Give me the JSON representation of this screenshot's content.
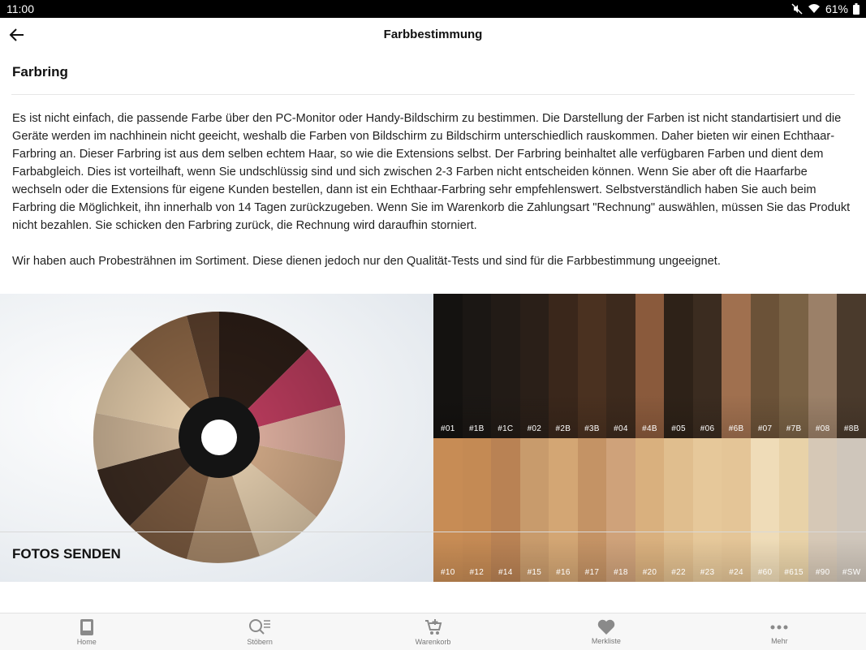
{
  "status_bar": {
    "time": "11:00",
    "battery": "61%"
  },
  "app_bar": {
    "title": "Farbbestimmung"
  },
  "section": {
    "title": "Farbring",
    "paragraphs": [
      "Es ist nicht einfach, die passende Farbe über den PC-Monitor oder Handy-Bildschirm zu bestimmen. Die Darstellung der Farben ist nicht standartisiert und die Geräte werden im nachhinein nicht geeicht, weshalb die Farben von Bildschirm zu Bildschirm unterschiedlich rauskommen. Daher bieten wir einen Echthaar-Farbring an. Dieser Farbring ist aus dem selben echtem Haar, so wie die Extensions selbst. Der Farbring beinhaltet alle verfügbaren Farben und dient dem Farbabgleich. Dies ist vorteilhaft, wenn Sie undschlüssig sind und sich zwischen 2-3 Farben nicht entscheiden können. Wenn Sie aber oft die Haarfarbe wechseln oder die Extensions für eigene Kunden bestellen, dann ist ein Echthaar-Farbring sehr empfehlenswert. Selbstverständlich haben Sie auch beim Farbring die Möglichkeit, ihn innerhalb von 14 Tagen zurückzugeben. Wenn Sie im Warenkorb die Zahlungsart \"Rechnung\" auswählen, müssen Sie das Produkt nicht bezahlen. Sie schicken den Farbring zurück, die Rechnung wird daraufhin storniert.",
      "Wir haben auch Probesträhnen im Sortiment. Diese dienen jedoch nur den Qualität-Tests und sind für die Farbbestimmung ungeeignet."
    ]
  },
  "swatches": {
    "top": [
      {
        "label": "#01",
        "color": "#141210"
      },
      {
        "label": "#1B",
        "color": "#1b1714"
      },
      {
        "label": "#1C",
        "color": "#221b16"
      },
      {
        "label": "#02",
        "color": "#2a1f18"
      },
      {
        "label": "#2B",
        "color": "#3a271b"
      },
      {
        "label": "#3B",
        "color": "#4a3120"
      },
      {
        "label": "#04",
        "color": "#3d2a1d"
      },
      {
        "label": "#4B",
        "color": "#8a5a3c"
      },
      {
        "label": "#05",
        "color": "#2e2218"
      },
      {
        "label": "#06",
        "color": "#3b2c20"
      },
      {
        "label": "#6B",
        "color": "#a0704f"
      },
      {
        "label": "#07",
        "color": "#6b5238"
      },
      {
        "label": "#7B",
        "color": "#7a6245"
      },
      {
        "label": "#08",
        "color": "#9b8068"
      },
      {
        "label": "#8B",
        "color": "#4a3a2c"
      }
    ],
    "bottom": [
      {
        "label": "#10",
        "color": "#c78c55"
      },
      {
        "label": "#12",
        "color": "#c48a54"
      },
      {
        "label": "#14",
        "color": "#b98254"
      },
      {
        "label": "#15",
        "color": "#c89b6c"
      },
      {
        "label": "#16",
        "color": "#d3a674"
      },
      {
        "label": "#17",
        "color": "#c49365"
      },
      {
        "label": "#18",
        "color": "#cfa27a"
      },
      {
        "label": "#20",
        "color": "#d9b07e"
      },
      {
        "label": "#22",
        "color": "#e0be8e"
      },
      {
        "label": "#23",
        "color": "#e6c89a"
      },
      {
        "label": "#24",
        "color": "#e4c597"
      },
      {
        "label": "#60",
        "color": "#efdcb8"
      },
      {
        "label": "#615",
        "color": "#e8d2a8"
      },
      {
        "label": "#90",
        "color": "#d6c8b6"
      },
      {
        "label": "#SW",
        "color": "#cfc6bb"
      }
    ]
  },
  "section2": {
    "title": "FOTOS SENDEN"
  },
  "bottom_nav": [
    {
      "label": "Home",
      "icon": "home-icon"
    },
    {
      "label": "Stöbern",
      "icon": "search-icon"
    },
    {
      "label": "Warenkorb",
      "icon": "cart-icon"
    },
    {
      "label": "Merkliste",
      "icon": "heart-icon"
    },
    {
      "label": "Mehr",
      "icon": "more-icon"
    }
  ]
}
